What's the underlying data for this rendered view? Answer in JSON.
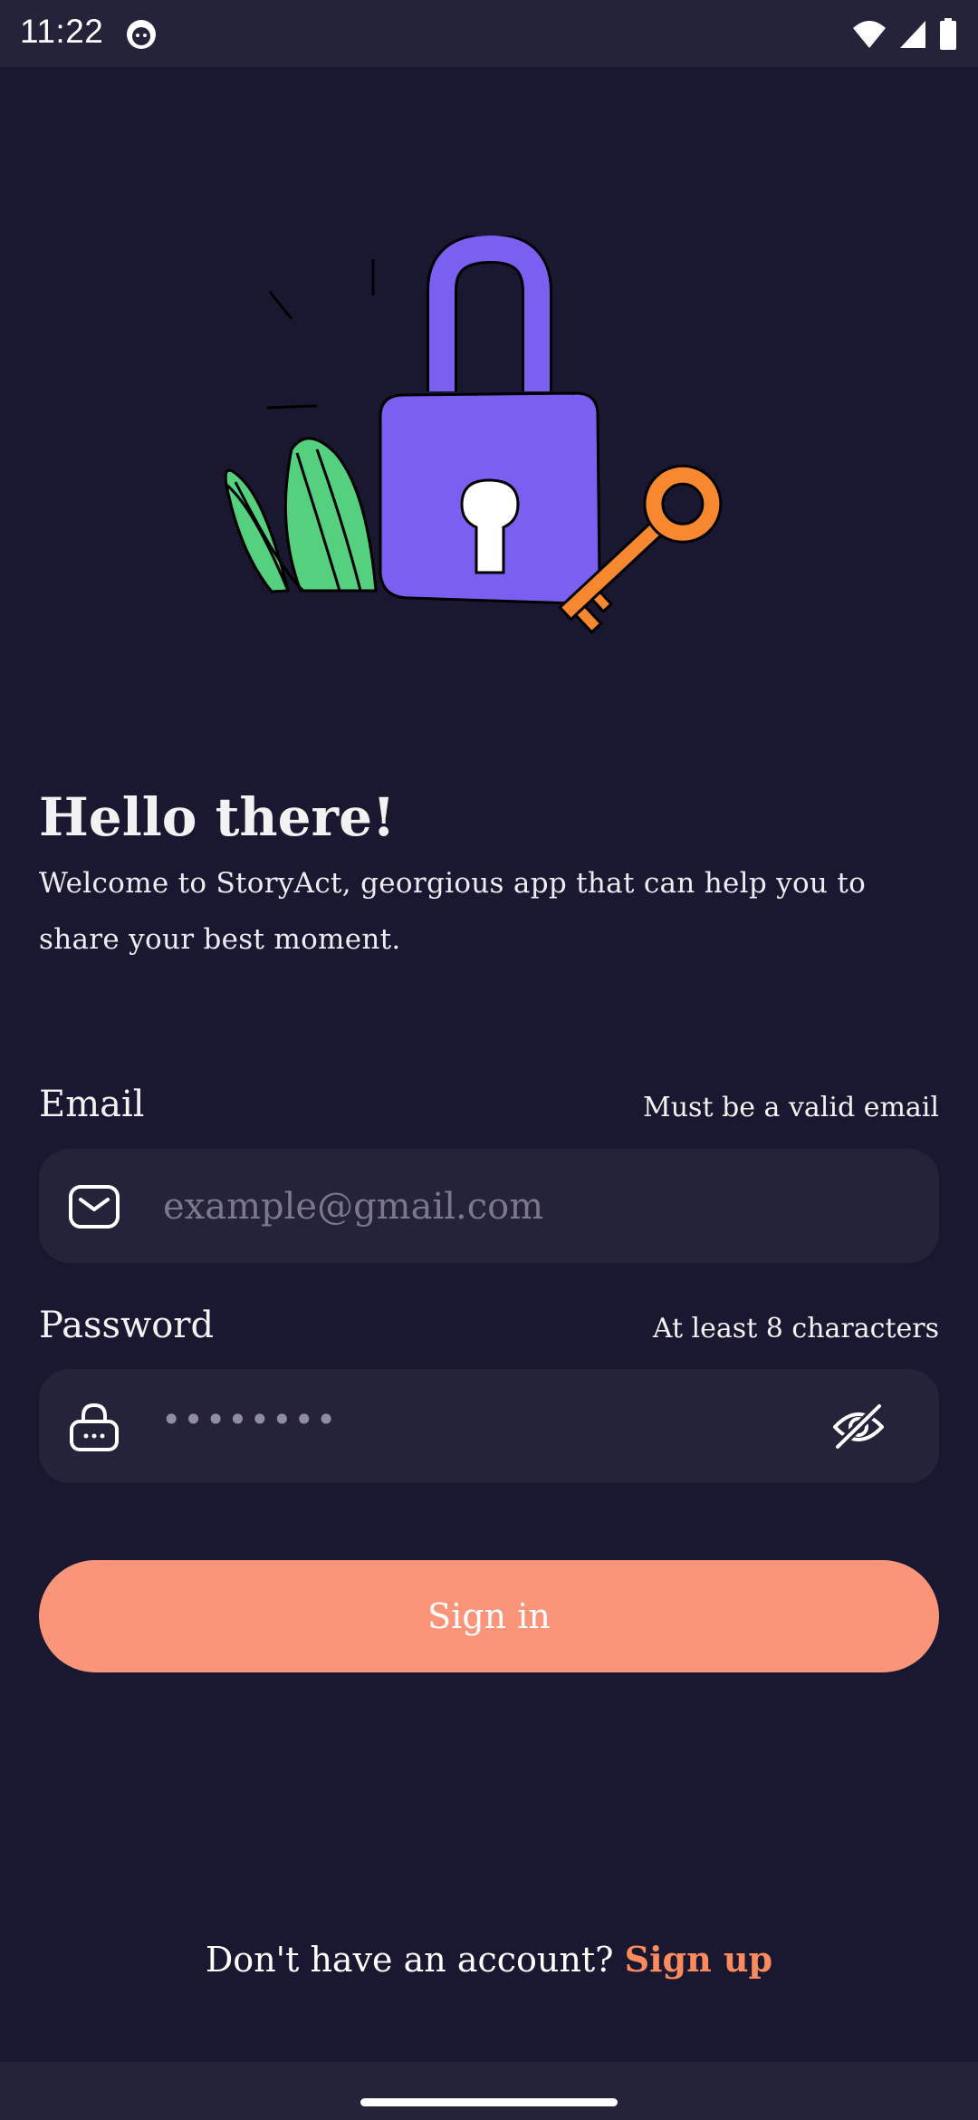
{
  "status_bar": {
    "time": "11:22"
  },
  "login": {
    "title": "Hello there!",
    "subtitle": "Welcome to StoryAct, georgious app that can help you to share your best moment."
  },
  "email": {
    "label": "Email",
    "hint": "Must be a valid email",
    "placeholder": "example@gmail.com",
    "icon": "mail-icon"
  },
  "password": {
    "label": "Password",
    "hint": "At least 8 characters",
    "masked_value": "••••••••",
    "icon": "lock-icon",
    "toggle_icon": "eye-off-icon"
  },
  "signin_label": "Sign in",
  "footer": {
    "prompt": "Don't have an account?",
    "link": "Sign up"
  },
  "colors": {
    "background": "#1a1830",
    "field": "#25233a",
    "accent": "#fb9579",
    "link": "#fb8a5c",
    "lock": "#7b5ff0",
    "key": "#f7882f",
    "leaf": "#55d07f"
  }
}
